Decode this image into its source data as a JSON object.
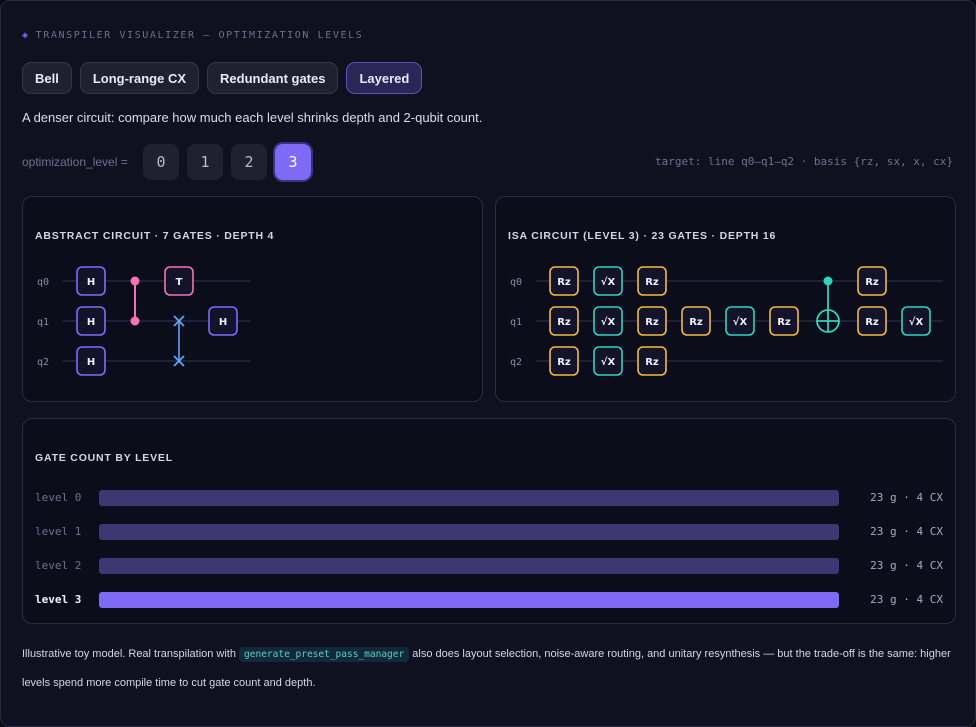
{
  "header": {
    "title": "TRANSPILER VISUALIZER — OPTIMIZATION LEVELS"
  },
  "presets": [
    {
      "label": "Bell",
      "active": false
    },
    {
      "label": "Long-range CX",
      "active": false
    },
    {
      "label": "Redundant gates",
      "active": false
    },
    {
      "label": "Layered",
      "active": true
    }
  ],
  "description": "A denser circuit: compare how much each level shrinks depth and 2-qubit count.",
  "optimization": {
    "label": "optimization_level =",
    "levels": [
      "0",
      "1",
      "2",
      "3"
    ],
    "selected": "3",
    "target": "target: line q0—q1—q2 · basis {rz, sx, x, cx}"
  },
  "abstract_circuit": {
    "title": "ABSTRACT CIRCUIT · 7 GATES · DEPTH 4",
    "qubits": [
      "q0",
      "q1",
      "q2"
    ],
    "gates": [
      {
        "type": "box",
        "label": "H",
        "qubit": 0,
        "col": 0,
        "color": "#7c6cff"
      },
      {
        "type": "box",
        "label": "H",
        "qubit": 1,
        "col": 0,
        "color": "#7c6cff"
      },
      {
        "type": "box",
        "label": "H",
        "qubit": 2,
        "col": 0,
        "color": "#7c6cff"
      },
      {
        "type": "cz",
        "qubits": [
          0,
          1
        ],
        "col": 1,
        "color": "#f472b6"
      },
      {
        "type": "box",
        "label": "T",
        "qubit": 0,
        "col": 2,
        "color": "#f472b6"
      },
      {
        "type": "swap",
        "qubits": [
          1,
          2
        ],
        "col": 2,
        "color": "#60a5fa"
      },
      {
        "type": "box",
        "label": "H",
        "qubit": 1,
        "col": 3,
        "color": "#7c6cff"
      }
    ]
  },
  "isa_circuit": {
    "title": "ISA CIRCUIT (LEVEL 3) · 23 GATES · DEPTH 16",
    "qubits": [
      "q0",
      "q1",
      "q2"
    ],
    "gates": [
      {
        "type": "box",
        "label": "Rz",
        "qubit": 0,
        "col": 0,
        "color": "#f5b942"
      },
      {
        "type": "box",
        "label": "√X",
        "qubit": 0,
        "col": 1,
        "color": "#2dd4bf"
      },
      {
        "type": "box",
        "label": "Rz",
        "qubit": 0,
        "col": 2,
        "color": "#f5b942"
      },
      {
        "type": "box",
        "label": "Rz",
        "qubit": 1,
        "col": 0,
        "color": "#f5b942"
      },
      {
        "type": "box",
        "label": "√X",
        "qubit": 1,
        "col": 1,
        "color": "#2dd4bf"
      },
      {
        "type": "box",
        "label": "Rz",
        "qubit": 1,
        "col": 2,
        "color": "#f5b942"
      },
      {
        "type": "box",
        "label": "Rz",
        "qubit": 2,
        "col": 0,
        "color": "#f5b942"
      },
      {
        "type": "box",
        "label": "√X",
        "qubit": 2,
        "col": 1,
        "color": "#2dd4bf"
      },
      {
        "type": "box",
        "label": "Rz",
        "qubit": 2,
        "col": 2,
        "color": "#f5b942"
      },
      {
        "type": "box",
        "label": "Rz",
        "qubit": 1,
        "col": 3,
        "color": "#f5b942"
      },
      {
        "type": "box",
        "label": "√X",
        "qubit": 1,
        "col": 4,
        "color": "#2dd4bf"
      },
      {
        "type": "box",
        "label": "Rz",
        "qubit": 1,
        "col": 5,
        "color": "#f5b942"
      },
      {
        "type": "cx",
        "qubits": [
          0,
          1
        ],
        "col": 6,
        "color": "#2dd4bf"
      },
      {
        "type": "box",
        "label": "Rz",
        "qubit": 0,
        "col": 7,
        "color": "#f5b942"
      },
      {
        "type": "box",
        "label": "Rz",
        "qubit": 1,
        "col": 7,
        "color": "#f5b942"
      },
      {
        "type": "box",
        "label": "√X",
        "qubit": 1,
        "col": 8,
        "color": "#2dd4bf"
      }
    ]
  },
  "gate_count": {
    "title": "GATE COUNT BY LEVEL",
    "rows": [
      {
        "label": "level 0",
        "fraction": 1.0,
        "value": "23 g · 4 CX",
        "active": false
      },
      {
        "label": "level 1",
        "fraction": 1.0,
        "value": "23 g · 4 CX",
        "active": false
      },
      {
        "label": "level 2",
        "fraction": 1.0,
        "value": "23 g · 4 CX",
        "active": false
      },
      {
        "label": "level 3",
        "fraction": 1.0,
        "value": "23 g · 4 CX",
        "active": true
      }
    ]
  },
  "footer": {
    "text_before": "Illustrative toy model. Real transpilation with",
    "code": "generate_preset_pass_manager",
    "text_after": "also does layout selection, noise-aware routing, and unitary resynthesis — but the trade-off is the same: higher levels spend more compile time to cut gate count and depth."
  }
}
